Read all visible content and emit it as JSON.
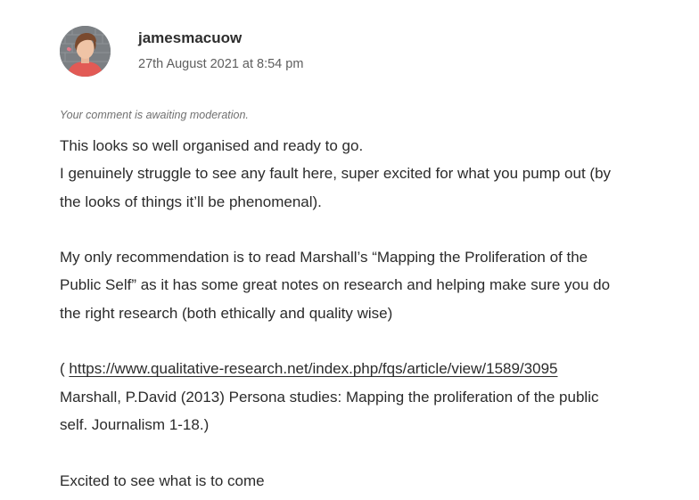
{
  "comment": {
    "author": "jamesmacuow",
    "date": "27th August 2021 at 8:54 pm",
    "moderation_notice": "Your comment is awaiting moderation.",
    "avatar_icon": "user-avatar-icon",
    "lines": {
      "l1": "This looks so well organised and ready to go.",
      "l2": "I genuinely struggle to see any fault here, super excited for what you pump out (by",
      "l3": "the looks of things it’ll be phenomenal).",
      "l4": "My only recommendation is to read Marshall’s “Mapping the Proliferation of the",
      "l5": "Public Self” as it has some great notes on research and helping make sure you do",
      "l6": "the right research (both ethically and quality wise)",
      "l7_prefix": "( ",
      "l7_link": "https://www.qualitative-research.net/index.php/fqs/article/view/1589/3095",
      "l8": "Marshall, P.David (2013) Persona studies: Mapping the proliferation of the public",
      "l9": "self. Journalism 1-18.)",
      "l10": "Excited to see what is to come"
    }
  }
}
